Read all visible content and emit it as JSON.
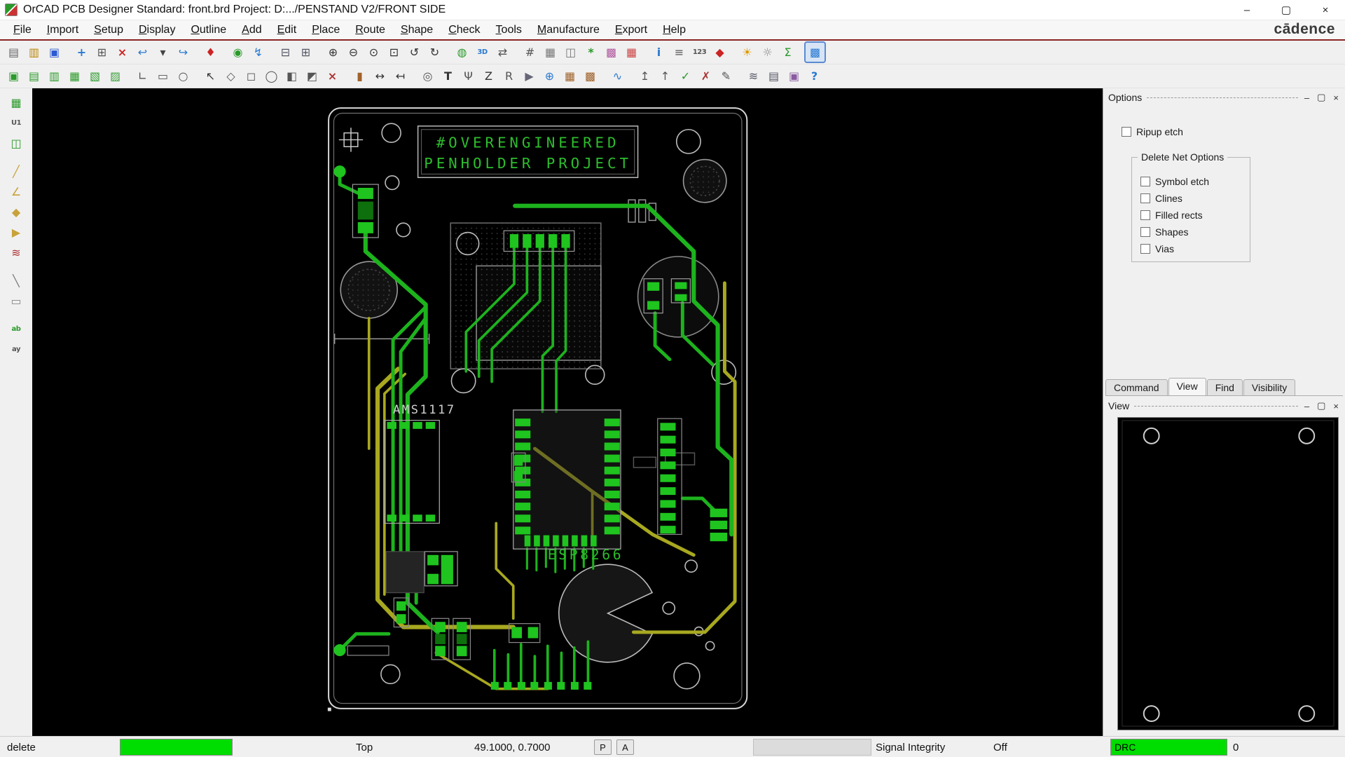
{
  "window": {
    "title": "OrCAD PCB Designer Standard: front.brd  Project: D:.../PENSTAND V2/FRONT SIDE",
    "controls": {
      "minimize": "–",
      "maximize": "▢",
      "close": "×"
    },
    "brand": "cādence"
  },
  "menu": {
    "items": [
      "File",
      "Import",
      "Setup",
      "Display",
      "Outline",
      "Add",
      "Edit",
      "Place",
      "Route",
      "Shape",
      "Check",
      "Tools",
      "Manufacture",
      "Export",
      "Help"
    ]
  },
  "toolbar": {
    "row1": [
      {
        "name": "new-file",
        "glyph": "▤",
        "color": "#666666"
      },
      {
        "name": "open-file",
        "glyph": "▥",
        "color": "#b8860b"
      },
      {
        "name": "save-file",
        "glyph": "▣",
        "color": "#2a5ad2"
      },
      {
        "name": "move",
        "glyph": "+",
        "color": "#2a7ad2",
        "sep": true,
        "bold": true
      },
      {
        "name": "copy",
        "glyph": "⊞",
        "color": "#555555"
      },
      {
        "name": "delete",
        "glyph": "×",
        "color": "#cc2222",
        "bold": true
      },
      {
        "name": "undo",
        "glyph": "↩",
        "color": "#2a7ad2"
      },
      {
        "name": "undo-more",
        "glyph": "▾",
        "color": "#444444"
      },
      {
        "name": "redo",
        "glyph": "↪",
        "color": "#2a7ad2"
      },
      {
        "name": "pin",
        "glyph": "♦",
        "color": "#cc2222",
        "sep": true
      },
      {
        "name": "world-zoom",
        "glyph": "◉",
        "color": "#2a9a2a",
        "sep": true
      },
      {
        "name": "route-fanout",
        "glyph": "↯",
        "color": "#2a7ad2"
      },
      {
        "name": "window-cascade",
        "glyph": "⊟",
        "color": "#555566",
        "sep": true
      },
      {
        "name": "window-tile",
        "glyph": "⊞",
        "color": "#555566"
      },
      {
        "name": "zoom-in",
        "glyph": "⊕",
        "color": "#333333",
        "sep": true
      },
      {
        "name": "zoom-out",
        "glyph": "⊖",
        "color": "#333333"
      },
      {
        "name": "zoom-points",
        "glyph": "⊙",
        "color": "#333333"
      },
      {
        "name": "zoom-fit",
        "glyph": "⊡",
        "color": "#333333"
      },
      {
        "name": "zoom-previous",
        "glyph": "↺",
        "color": "#333333"
      },
      {
        "name": "redraw",
        "glyph": "↻",
        "color": "#333333"
      },
      {
        "name": "world-view",
        "glyph": "◍",
        "color": "#2a9a2a",
        "sep": true
      },
      {
        "name": "view-3d",
        "glyph": "3D",
        "color": "#2a7ad2"
      },
      {
        "name": "flip-design",
        "glyph": "⇄",
        "color": "#555555"
      },
      {
        "name": "grid-toggle",
        "glyph": "#",
        "color": "#555555",
        "sep": true
      },
      {
        "name": "grid-settings",
        "glyph": "▦",
        "color": "#777777"
      },
      {
        "name": "padstack-editor",
        "glyph": "◫",
        "color": "#777777"
      },
      {
        "name": "shape-edit",
        "glyph": "*",
        "color": "#2a9a2a",
        "bold": true
      },
      {
        "name": "color-form",
        "glyph": "▩",
        "color": "#b05aa0"
      },
      {
        "name": "color-layers",
        "glyph": "▦",
        "color": "#cc4444"
      },
      {
        "name": "info",
        "glyph": "i",
        "color": "#2a7ad2",
        "sep": true,
        "bold": true
      },
      {
        "name": "properties",
        "glyph": "≡",
        "color": "#555555"
      },
      {
        "name": "find-123",
        "glyph": "123",
        "color": "#555555"
      },
      {
        "name": "waive-drc",
        "glyph": "◆",
        "color": "#cc2222"
      },
      {
        "name": "shine",
        "glyph": "☀",
        "color": "#e09a00",
        "sep": true
      },
      {
        "name": "shadow",
        "glyph": "☼",
        "color": "#888888"
      },
      {
        "name": "export-spreadsheet",
        "glyph": "Σ",
        "color": "#2a9a2a"
      },
      {
        "name": "ripup-etch",
        "glyph": "▩",
        "color": "#2a7ad2",
        "sep": true,
        "active": true
      }
    ],
    "row2": [
      {
        "name": "visibility-layer-a",
        "glyph": "▣",
        "color": "#2a9a2a"
      },
      {
        "name": "visibility-layer-b",
        "glyph": "▤",
        "color": "#2a9a2a"
      },
      {
        "name": "visibility-layer-c",
        "glyph": "▥",
        "color": "#2a9a2a"
      },
      {
        "name": "visibility-layer-d",
        "glyph": "▦",
        "color": "#2a9a2a"
      },
      {
        "name": "visibility-layer-e",
        "glyph": "▧",
        "color": "#2a9a2a"
      },
      {
        "name": "visibility-layer-f",
        "glyph": "▨",
        "color": "#3aa03a"
      },
      {
        "name": "add-line",
        "glyph": "∟",
        "color": "#555555",
        "sep": true
      },
      {
        "name": "add-rect",
        "glyph": "▭",
        "color": "#555555"
      },
      {
        "name": "add-circle",
        "glyph": "○",
        "color": "#555555"
      },
      {
        "name": "select-pointer",
        "glyph": "↖",
        "color": "#333333",
        "sep": true
      },
      {
        "name": "select-polygon",
        "glyph": "◇",
        "color": "#555555"
      },
      {
        "name": "select-rect",
        "glyph": "◻",
        "color": "#555555"
      },
      {
        "name": "select-circle",
        "glyph": "◯",
        "color": "#555555"
      },
      {
        "name": "select-shape",
        "glyph": "◧",
        "color": "#555555"
      },
      {
        "name": "shape-slant",
        "glyph": "◩",
        "color": "#555555"
      },
      {
        "name": "vertex-delete",
        "glyph": "×",
        "color": "#aa3333",
        "bold": true
      },
      {
        "name": "pad-tool",
        "glyph": "▮",
        "color": "#a0622a",
        "sep": true
      },
      {
        "name": "measure",
        "glyph": "↔",
        "color": "#333333"
      },
      {
        "name": "dimension",
        "glyph": "↤",
        "color": "#333333"
      },
      {
        "name": "odb-export",
        "glyph": "◎",
        "color": "#555555",
        "sep": true
      },
      {
        "name": "text-tool",
        "glyph": "T",
        "color": "#333333",
        "bold": true
      },
      {
        "name": "design-audit",
        "glyph": "Ψ",
        "color": "#555555"
      },
      {
        "name": "zoom-command",
        "glyph": "Z",
        "color": "#333333"
      },
      {
        "name": "reports",
        "glyph": "R",
        "color": "#555555"
      },
      {
        "name": "flag-mode",
        "glyph": "▶",
        "color": "#666677"
      },
      {
        "name": "snap-target",
        "glyph": "⊕",
        "color": "#2a7ad2"
      },
      {
        "name": "grid-copper-a",
        "glyph": "▦",
        "color": "#a0622a"
      },
      {
        "name": "grid-copper-b",
        "glyph": "▩",
        "color": "#a0622a"
      },
      {
        "name": "net-tool",
        "glyph": "∿",
        "color": "#2a7ad2",
        "sep": true
      },
      {
        "name": "export-top",
        "glyph": "↥",
        "color": "#555555",
        "sep": true
      },
      {
        "name": "clipboard-up",
        "glyph": "↑",
        "color": "#555555"
      },
      {
        "name": "clipboard-check",
        "glyph": "✓",
        "color": "#2a9a2a",
        "bold": true
      },
      {
        "name": "clipboard-reject",
        "glyph": "✗",
        "color": "#aa3333"
      },
      {
        "name": "edit-pencil",
        "glyph": "✎",
        "color": "#555555"
      },
      {
        "name": "layer-stack",
        "glyph": "≋",
        "color": "#555566",
        "sep": true
      },
      {
        "name": "artwork-film",
        "glyph": "▤",
        "color": "#555566"
      },
      {
        "name": "image-export",
        "glyph": "▣",
        "color": "#8a5aa0"
      },
      {
        "name": "help",
        "glyph": "?",
        "color": "#2a7ad2",
        "bold": true
      }
    ],
    "left": [
      {
        "name": "design-browser",
        "glyph": "▦",
        "color": "#2a9a2a"
      },
      {
        "name": "component-u1",
        "glyph": "U1",
        "color": "#555555"
      },
      {
        "name": "padstack-browser",
        "glyph": "◫",
        "color": "#2a9a2a"
      },
      {
        "name": "wrench-tool",
        "glyph": "╱",
        "color": "#c8a23a",
        "sep": true,
        "bold": true
      },
      {
        "name": "angle-measure",
        "glyph": "∠",
        "color": "#c8a23a"
      },
      {
        "name": "derive-tool",
        "glyph": "◆",
        "color": "#c8a23a"
      },
      {
        "name": "play-arrow",
        "glyph": "▶",
        "color": "#c8a23a"
      },
      {
        "name": "stackup",
        "glyph": "≋",
        "color": "#b03333"
      },
      {
        "name": "line-tool",
        "glyph": "╲",
        "color": "#777777",
        "sep": true
      },
      {
        "name": "rect-tool",
        "glyph": "▭",
        "color": "#888888"
      },
      {
        "name": "text-add",
        "glyph": "ab",
        "color": "#2a9a2a",
        "sep": true
      },
      {
        "name": "text-edit",
        "glyph": "ay",
        "color": "#555555"
      }
    ]
  },
  "options_panel": {
    "title": "Options",
    "ripup_label": "Ripup etch",
    "group_title": "Delete Net Options",
    "group_items": [
      "Symbol etch",
      "Clines",
      "Filled rects",
      "Shapes",
      "Vias"
    ]
  },
  "panel_buttons": {
    "minimize": "–",
    "float": "▢",
    "close": "×"
  },
  "tabs": {
    "items": [
      {
        "label": "Command",
        "active": false
      },
      {
        "label": "View",
        "active": true
      },
      {
        "label": "Find",
        "active": false
      },
      {
        "label": "Visibility",
        "active": false
      }
    ]
  },
  "view_panel": {
    "title": "View"
  },
  "canvas": {
    "board": {
      "title_line1": "#OVERENGINEERED",
      "title_line2": "PENHOLDER PROJECT",
      "ic_label": "ESP8266",
      "regulator_label": "AMS1117"
    }
  },
  "statusbar": {
    "command": "delete",
    "layer": "Top",
    "coords": "49.1000, 0.7000",
    "pick_button": "P",
    "angle_button": "A",
    "signal_integrity": "Signal Integrity",
    "dynamics": "Off",
    "drc_label": "DRC",
    "drc_count": "0"
  }
}
